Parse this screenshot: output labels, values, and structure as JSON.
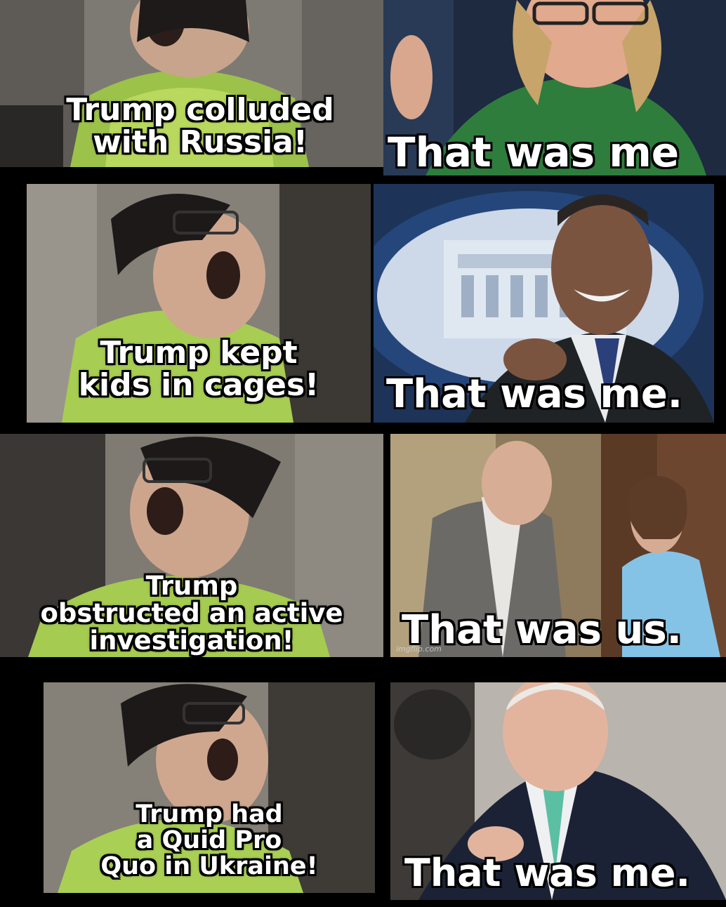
{
  "rows": [
    {
      "left_caption": [
        "Trump colluded",
        "with Russia!"
      ],
      "right_caption": "That was me"
    },
    {
      "left_caption": [
        "Trump kept",
        "kids in cages!"
      ],
      "right_caption": "That was me."
    },
    {
      "left_caption": [
        "Trump",
        "obstructed an active",
        "investigation!"
      ],
      "right_caption": "That was us.",
      "watermark": "imgflip.com"
    },
    {
      "left_caption": [
        "Trump had",
        "a Quid Pro",
        "Quo in Ukraine!"
      ],
      "right_caption": "That was me."
    }
  ]
}
